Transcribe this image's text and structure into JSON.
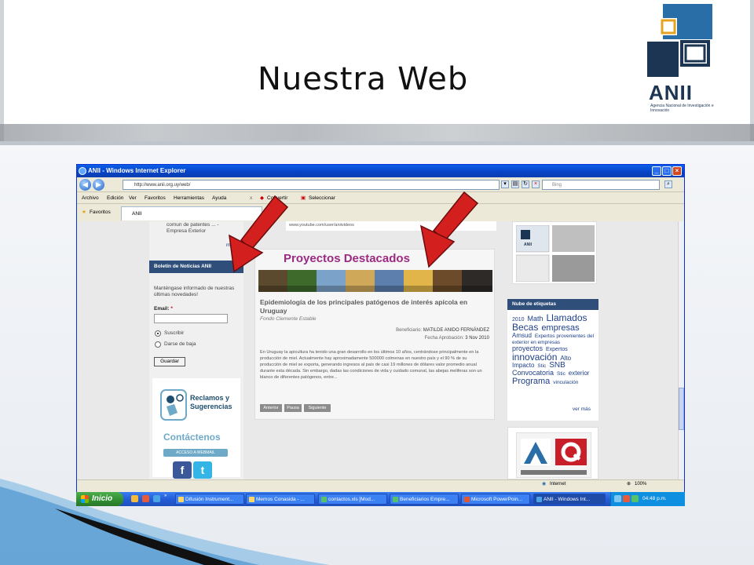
{
  "slide": {
    "title": "Nuestra Web",
    "logo": {
      "name": "ANII",
      "subtitle": "Agencia Nacional de Investigación e Innovación"
    },
    "colors": {
      "logo_navy": "#1b3552",
      "logo_lightblue": "#2a6ea8",
      "accent_arrow": "#d41f1f"
    }
  },
  "browser": {
    "title": "ANII - Windows Internet Explorer",
    "url": "http://www.anii.org.uy/web/",
    "search_placeholder": "Bing",
    "menu": [
      "Archivo",
      "Edición",
      "Ver",
      "Favoritos",
      "Herramientas",
      "Ayuda"
    ],
    "menu_close": "x",
    "tools": [
      "Convertir",
      "Seleccionar"
    ],
    "favorites_label": "Favoritos",
    "tab_label": "ANII",
    "status": {
      "zone": "Internet",
      "zoom": "100%"
    }
  },
  "page": {
    "left": {
      "top_link": "comun de patentes ... - Empresa Exterior",
      "top_more": "m",
      "newsletter": {
        "heading": "Boletín de Noticias ANII",
        "intro": "Manténgase informado de nuestras últimas novedades!",
        "email_label": "Email:",
        "required_mark": "*",
        "options": [
          "Suscribir",
          "Darse de baja"
        ],
        "selected_option": "Suscribir",
        "submit": "Guardar"
      },
      "reclamos": "Reclamos y Sugerencias",
      "contactenos": "Contáctenos",
      "webmail": "ACCESO A WEBMAIL",
      "social_icons": [
        "facebook-icon",
        "twitter-icon"
      ]
    },
    "center": {
      "video_link": "www.youtube.com/user/aniivideos",
      "section_title": "Proyectos Destacados",
      "project": {
        "title": "Epidemiología de los principales patógenos de interés apícola en Uruguay",
        "fund": "Fondo Clemente Estable",
        "beneficiary_label": "Beneficiario:",
        "beneficiary": "MATILDE ANIDO FERNÁNDEZ",
        "date_label": "Fecha Aprobación:",
        "date": "3 Nov 2010",
        "body": "En Uruguay la apicultura ha tenido una gran desarrollo en los últimos 10 años, centrándose principalmente en la producción de miel. Actualmente hay aproximadamente 500000 colmenas en nuestro país y el 90 % de su producción de miel se exporta, generando ingresos al país de casi 19 millones de dólares valor promedio anual durante esta década. Sin embargo, dadas las condiciones de vida y cuidado comunal, las abejas meliferas son un blanco de diferentes patógenos, entre..."
      },
      "slider_buttons": [
        "Anterior",
        "Pausa",
        "Siguiente"
      ]
    },
    "right": {
      "tag_cloud_heading": "Nube de etiquetas",
      "tags": [
        {
          "text": "2010",
          "size": 7
        },
        {
          "text": "Math",
          "size": 9
        },
        {
          "text": "Llamados",
          "size": 12
        },
        {
          "text": "Becas",
          "size": 12
        },
        {
          "text": "empresas",
          "size": 11
        },
        {
          "text": "Amsud",
          "size": 8
        },
        {
          "text": "Expertos provenientes del exterior en empresas",
          "size": 6.5
        },
        {
          "text": "proyectos",
          "size": 9
        },
        {
          "text": "Expertos",
          "size": 7
        },
        {
          "text": "innovación",
          "size": 12
        },
        {
          "text": "Alto Impacto",
          "size": 8
        },
        {
          "text": "Stic",
          "size": 6.5
        },
        {
          "text": "SNB",
          "size": 10
        },
        {
          "text": "Convocatoria",
          "size": 9
        },
        {
          "text": "Stic",
          "size": 6.5
        },
        {
          "text": "exterior",
          "size": 8
        },
        {
          "text": "Programa",
          "size": 11
        },
        {
          "text": "vinculación",
          "size": 6.5
        }
      ],
      "more_link": "ver más",
      "thumb_caption": "ANII"
    }
  },
  "taskbar": {
    "start": "Inicio",
    "items": [
      "Difusión Instrument...",
      "Memos Conasida - ...",
      "contactos.xls [Mod...",
      "Beneficiarios Empre...",
      "Microsoft PowerPoin...",
      "ANII - Windows Int..."
    ],
    "clock": "04:48 p.m."
  }
}
